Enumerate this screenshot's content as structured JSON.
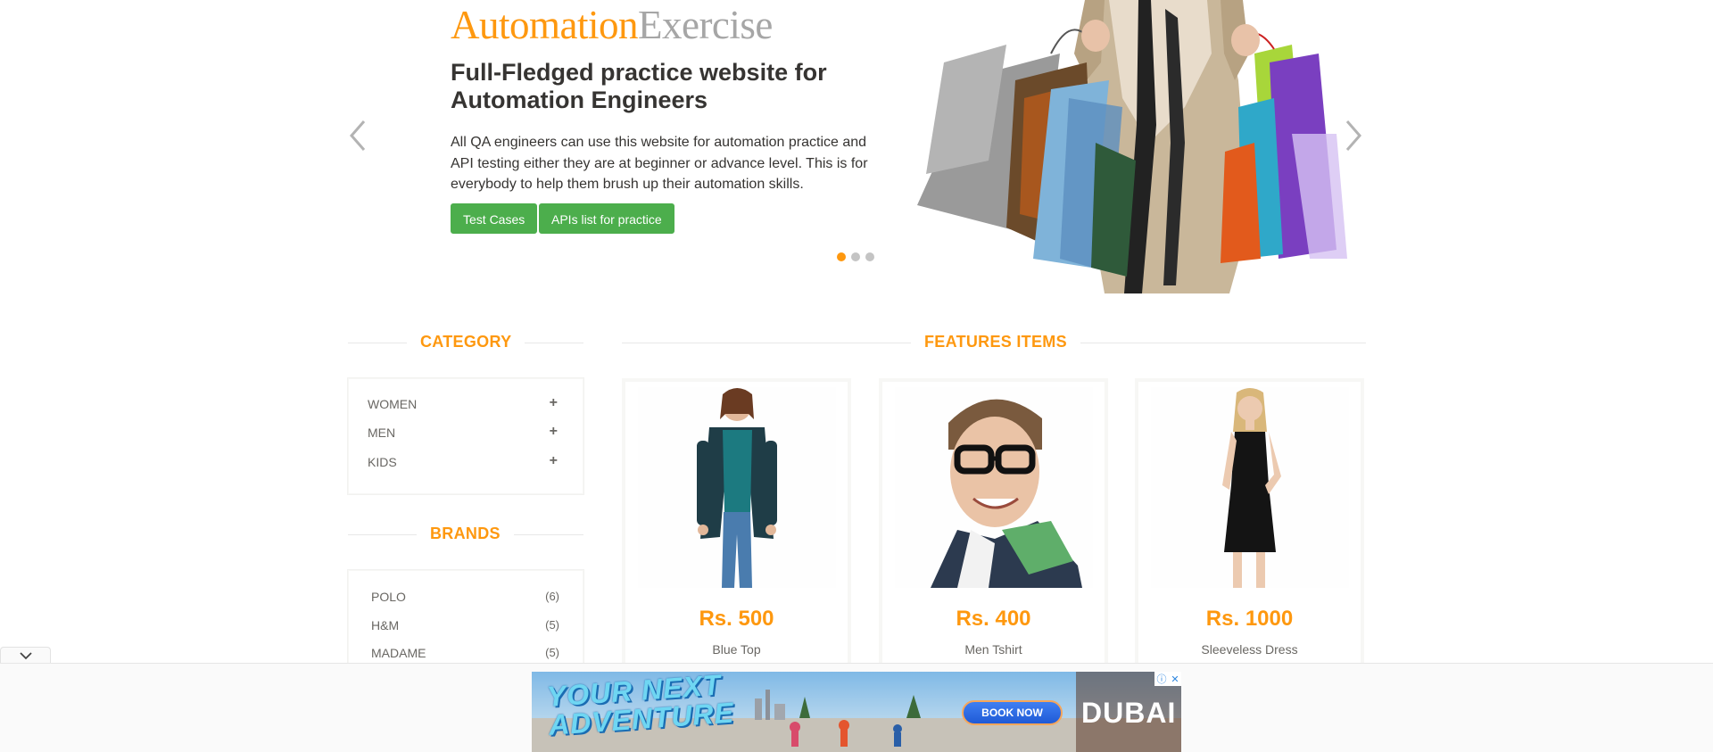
{
  "slider": {
    "brand_part1": "Automation",
    "brand_part2": "Exercise",
    "heading": "Full-Fledged practice website for Automation Engineers",
    "text": "All QA engineers can use this website for automation practice and API testing either they are at beginner or advance level. This is for everybody to help them brush up their automation skills.",
    "btn_test_cases": "Test Cases",
    "btn_apis": "APIs list for practice",
    "active_slide": 1,
    "slide_count": 3
  },
  "category": {
    "title": "CATEGORY",
    "items": [
      {
        "label": "Women",
        "toggle": "+"
      },
      {
        "label": "Men",
        "toggle": "+"
      },
      {
        "label": "Kids",
        "toggle": "+"
      }
    ]
  },
  "brands": {
    "title": "BRANDS",
    "items": [
      {
        "label": "POLO",
        "count": "(6)"
      },
      {
        "label": "H&M",
        "count": "(5)"
      },
      {
        "label": "MADAME",
        "count": "(5)"
      }
    ]
  },
  "features": {
    "title": "FEATURES ITEMS",
    "products": [
      {
        "price": "Rs. 500",
        "name": "Blue Top"
      },
      {
        "price": "Rs. 400",
        "name": "Men Tshirt"
      },
      {
        "price": "Rs. 1000",
        "name": "Sleeveless Dress"
      }
    ]
  },
  "ad": {
    "headline": "YOUR NEXT\nADVENTURE",
    "cta": "BOOK NOW",
    "logo": "DUBAI",
    "info_icon": "ⓘ",
    "close_icon": "✕"
  },
  "colors": {
    "accent": "#fe980f",
    "button_green": "#4cae4c",
    "text": "#363432",
    "muted": "#696763"
  }
}
